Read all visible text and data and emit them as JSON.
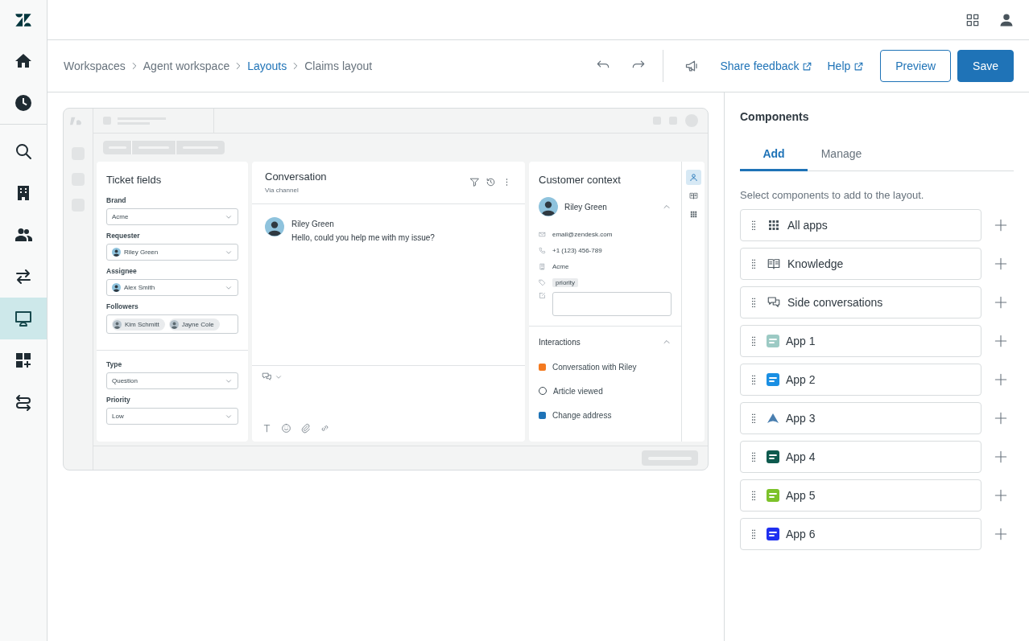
{
  "nav": {
    "items": [
      {
        "kind": "home",
        "selected": false
      },
      {
        "kind": "clock",
        "selected": false
      },
      {
        "kind": "search",
        "selected": false
      },
      {
        "kind": "building",
        "selected": false
      },
      {
        "kind": "people",
        "selected": false
      },
      {
        "kind": "arrows",
        "selected": false
      },
      {
        "kind": "monitor",
        "selected": true
      },
      {
        "kind": "add-grid",
        "selected": false
      },
      {
        "kind": "flow",
        "selected": false
      }
    ]
  },
  "breadcrumb": [
    {
      "label": "Workspaces",
      "link": false
    },
    {
      "label": "Agent workspace",
      "link": false
    },
    {
      "label": "Layouts",
      "link": true
    },
    {
      "label": "Claims layout",
      "link": false
    }
  ],
  "links": [
    {
      "label": "Share feedback"
    },
    {
      "label": "Help"
    }
  ],
  "buttons": [
    {
      "label": "Preview",
      "kind": "secondary"
    },
    {
      "label": "Save",
      "kind": "primary"
    }
  ],
  "preview": {
    "ticket_fields": {
      "title": "Ticket fields",
      "sections": [
        {
          "fields": [
            {
              "label": "Brand",
              "kind": "select",
              "value": "Acme"
            },
            {
              "label": "Requester",
              "kind": "person",
              "value": "Riley Green"
            },
            {
              "label": "Assignee",
              "kind": "person",
              "value": "Alex Smith"
            },
            {
              "label": "Followers",
              "kind": "tags",
              "values": [
                "Kim Schmitt",
                "Jayne Cole"
              ]
            }
          ]
        },
        {
          "fields": [
            {
              "label": "Type",
              "kind": "select",
              "value": "Question"
            },
            {
              "label": "Priority",
              "kind": "select",
              "value": "Low"
            }
          ]
        }
      ]
    },
    "conversation": {
      "title": "Conversation",
      "subtitle": "Via channel",
      "messages": [
        {
          "author": "Riley Green",
          "text": "Hello, could you help me with my issue?"
        }
      ]
    },
    "customer_context": {
      "title": "Customer context",
      "customer": {
        "name": "Riley Green",
        "expanded": true
      },
      "details": [
        {
          "kind": "email",
          "value": "email@zendesk.com"
        },
        {
          "kind": "phone",
          "value": "+1 (123) 456-789"
        },
        {
          "kind": "org",
          "value": "Acme"
        },
        {
          "kind": "tag",
          "value": "priority"
        },
        {
          "kind": "note"
        }
      ],
      "interactions": {
        "title": "Interactions",
        "expanded": true,
        "items": [
          {
            "kind": "badge",
            "color": "#f47a20",
            "label": "Conversation with Riley"
          },
          {
            "kind": "circle",
            "label": "Article viewed"
          },
          {
            "kind": "badge",
            "color": "#1f73b7",
            "label": "Change address"
          }
        ]
      }
    },
    "rail": [
      {
        "kind": "person",
        "selected": true
      },
      {
        "kind": "book",
        "selected": false
      },
      {
        "kind": "grid",
        "selected": false
      }
    ]
  },
  "components": {
    "title": "Components",
    "tabs": [
      {
        "label": "Add",
        "selected": true
      },
      {
        "label": "Manage",
        "selected": false
      }
    ],
    "hint": "Select components to add to the layout.",
    "items": [
      {
        "label": "All apps",
        "kind": "grid"
      },
      {
        "label": "Knowledge",
        "kind": "book"
      },
      {
        "label": "Side conversations",
        "kind": "chat"
      },
      {
        "label": "App 1",
        "kind": "app",
        "color": "#9ccac4"
      },
      {
        "label": "App 2",
        "kind": "app",
        "color": "#1a8fe3"
      },
      {
        "label": "App 3",
        "kind": "peak",
        "color": "#4a7fb0"
      },
      {
        "label": "App 4",
        "kind": "app",
        "color": "#0e5a4e"
      },
      {
        "label": "App 5",
        "kind": "app",
        "color": "#7cc22a"
      },
      {
        "label": "App 6",
        "kind": "app",
        "color": "#1f2ff0"
      }
    ]
  }
}
